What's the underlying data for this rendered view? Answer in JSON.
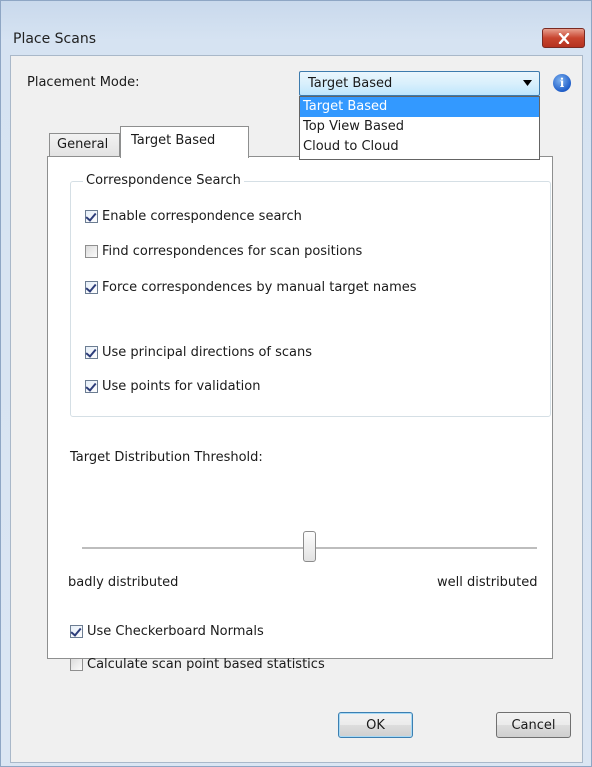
{
  "window": {
    "title": "Place Scans"
  },
  "placement": {
    "label": "Placement Mode:",
    "selected": "Target Based",
    "options": [
      "Target Based",
      "Top View Based",
      "Cloud to Cloud"
    ]
  },
  "tabs": [
    {
      "label": "General",
      "active": false
    },
    {
      "label": "Target Based",
      "active": true
    }
  ],
  "correspondence": {
    "title": "Correspondence Search",
    "items": [
      {
        "label": "Enable correspondence search",
        "checked": true
      },
      {
        "label": "Find correspondences for scan positions",
        "checked": false
      },
      {
        "label": "Force correspondences by manual target names",
        "checked": true
      },
      {
        "label": "Use principal directions of scans",
        "checked": true
      },
      {
        "label": "Use points for validation",
        "checked": true
      }
    ]
  },
  "threshold": {
    "label": "Target Distribution Threshold:",
    "min_label": "badly distributed",
    "max_label": "well distributed",
    "value": 0.5
  },
  "options": [
    {
      "label": "Use Checkerboard Normals",
      "checked": true
    },
    {
      "label": "Calculate scan point based statistics",
      "checked": false
    }
  ],
  "buttons": {
    "ok": "OK",
    "cancel": "Cancel"
  }
}
